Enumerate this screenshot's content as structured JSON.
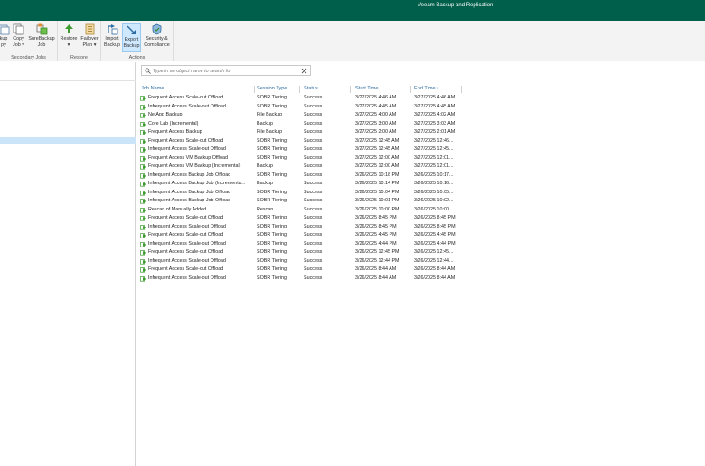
{
  "window": {
    "title": "Veeam Backup and Replication"
  },
  "ribbon": {
    "groups": [
      {
        "label": "Secondary Jobs"
      },
      {
        "label": "Restore"
      },
      {
        "label": "Actions"
      }
    ],
    "buttons": [
      {
        "line1": "kup",
        "line2": "py"
      },
      {
        "line1": "Copy",
        "line2": "Job ▾"
      },
      {
        "line1": "SureBackup",
        "line2": "Job"
      },
      {
        "line1": "Restore",
        "line2": "▾"
      },
      {
        "line1": "Failover",
        "line2": "Plan ▾"
      },
      {
        "line1": "Import",
        "line2": "Backup"
      },
      {
        "line1": "Export",
        "line2": "Backup"
      },
      {
        "line1": "Security &",
        "line2": "Compliance"
      }
    ]
  },
  "search": {
    "placeholder": "Type in an object name to search for"
  },
  "table": {
    "columns": {
      "job_name": "Job Name",
      "session_type": "Session Type",
      "status": "Status",
      "start_time": "Start Time",
      "end_time": "End Time ↓"
    },
    "rows": [
      {
        "job": "Frequent Access Scale-out Offload",
        "type": "SOBR Tiering",
        "status": "Success",
        "start": "3/27/2025 4:46 AM",
        "end": "3/27/2025 4:46 AM"
      },
      {
        "job": "Infrequent Access Scale-out Offload",
        "type": "SOBR Tiering",
        "status": "Success",
        "start": "3/27/2025 4:45 AM",
        "end": "3/27/2025 4:45 AM"
      },
      {
        "job": "NetApp Backup",
        "type": "File Backup",
        "status": "Success",
        "start": "3/27/2025 4:00 AM",
        "end": "3/27/2025 4:02 AM"
      },
      {
        "job": "Core Lab (Incremental)",
        "type": "Backup",
        "status": "Success",
        "start": "3/27/2025 3:00 AM",
        "end": "3/27/2025 3:03 AM"
      },
      {
        "job": "Frequent Access Backup",
        "type": "File Backup",
        "status": "Success",
        "start": "3/27/2025 2:00 AM",
        "end": "3/27/2025 2:01 AM"
      },
      {
        "job": "Frequent Access Scale-out Offload",
        "type": "SOBR Tiering",
        "status": "Success",
        "start": "3/27/2025 12:45 AM",
        "end": "3/27/2025 12:46..."
      },
      {
        "job": "Infrequent Access Scale-out Offload",
        "type": "SOBR Tiering",
        "status": "Success",
        "start": "3/27/2025 12:45 AM",
        "end": "3/27/2025 12:45..."
      },
      {
        "job": "Frequent Access VM Backup Offload",
        "type": "SOBR Tiering",
        "status": "Success",
        "start": "3/27/2025 12:00 AM",
        "end": "3/27/2025 12:01..."
      },
      {
        "job": "Frequent Access VM Backup (Incremental)",
        "type": "Backup",
        "status": "Success",
        "start": "3/27/2025 12:00 AM",
        "end": "3/27/2025 12:01..."
      },
      {
        "job": "Infrequent Access Backup Job Offload",
        "type": "SOBR Tiering",
        "status": "Success",
        "start": "3/26/2025 10:18 PM",
        "end": "3/26/2025 10:17..."
      },
      {
        "job": "Infrequent Access Backup Job (Incrementa...",
        "type": "Backup",
        "status": "Success",
        "start": "3/26/2025 10:14 PM",
        "end": "3/26/2025 10:16..."
      },
      {
        "job": "Infrequent Access Backup Job Offload",
        "type": "SOBR Tiering",
        "status": "Success",
        "start": "3/26/2025 10:04 PM",
        "end": "3/26/2025 10:05..."
      },
      {
        "job": "Infrequent Access Backup Job Offload",
        "type": "SOBR Tiering",
        "status": "Success",
        "start": "3/26/2025 10:01 PM",
        "end": "3/26/2025 10:02..."
      },
      {
        "job": "Rescan of Manually Added",
        "type": "Rescan",
        "status": "Success",
        "start": "3/26/2025 10:00 PM",
        "end": "3/26/2025 10:00..."
      },
      {
        "job": "Frequent Access Scale-out Offload",
        "type": "SOBR Tiering",
        "status": "Success",
        "start": "3/26/2025 8:45 PM",
        "end": "3/26/2025 8:45 PM"
      },
      {
        "job": "Infrequent Access Scale-out Offload",
        "type": "SOBR Tiering",
        "status": "Success",
        "start": "3/26/2025 8:45 PM",
        "end": "3/26/2025 8:45 PM"
      },
      {
        "job": "Frequent Access Scale-out Offload",
        "type": "SOBR Tiering",
        "status": "Success",
        "start": "3/26/2025 4:45 PM",
        "end": "3/26/2025 4:45 PM"
      },
      {
        "job": "Infrequent Access Scale-out Offload",
        "type": "SOBR Tiering",
        "status": "Success",
        "start": "3/26/2025 4:44 PM",
        "end": "3/26/2025 4:44 PM"
      },
      {
        "job": "Frequent Access Scale-out Offload",
        "type": "SOBR Tiering",
        "status": "Success",
        "start": "3/26/2025 12:45 PM",
        "end": "3/26/2025 12:45..."
      },
      {
        "job": "Infrequent Access Scale-out Offload",
        "type": "SOBR Tiering",
        "status": "Success",
        "start": "3/26/2025 12:44 PM",
        "end": "3/26/2025 12:44..."
      },
      {
        "job": "Frequent Access Scale-out Offload",
        "type": "SOBR Tiering",
        "status": "Success",
        "start": "3/26/2025 8:44 AM",
        "end": "3/26/2025 8:44 AM"
      },
      {
        "job": "Infrequent Access Scale-out Offload",
        "type": "SOBR Tiering",
        "status": "Success",
        "start": "3/26/2025 8:44 AM",
        "end": "3/26/2025 8:44 AM"
      }
    ]
  },
  "colors": {
    "titlebar": "#005f4b",
    "header_text": "#2d6ca2",
    "success_icon": "#3c9a2e",
    "selection": "#cce4f7"
  },
  "icons": [
    "search-icon",
    "clear-search-icon",
    "job-success-icon"
  ]
}
